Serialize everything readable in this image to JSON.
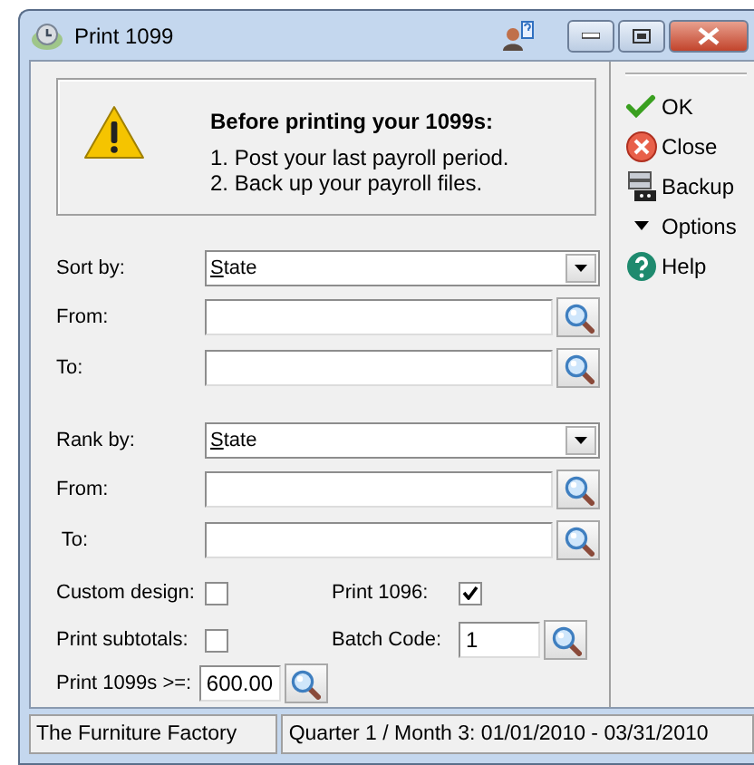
{
  "window": {
    "title": "Print 1099"
  },
  "notice": {
    "heading": "Before printing your 1099s:",
    "lines": [
      "1. Post your last payroll period.",
      "2. Back up your payroll files."
    ]
  },
  "sections": [
    {
      "rows": [
        {
          "kind": "select",
          "label": "Sort by:",
          "value": "State"
        },
        {
          "kind": "lookup",
          "label": "From:",
          "value": ""
        },
        {
          "kind": "lookup",
          "label": "To:",
          "value": ""
        }
      ]
    },
    {
      "rows": [
        {
          "kind": "select",
          "label": "Rank by:",
          "value": "State"
        },
        {
          "kind": "lookup",
          "label": "From:",
          "value": ""
        },
        {
          "kind": "lookup",
          "label": " To:",
          "value": ""
        }
      ]
    }
  ],
  "options": [
    [
      {
        "kind": "checkbox",
        "label": "Custom design:",
        "checked": false
      },
      {
        "kind": "checkbox",
        "label": "Print 1096:",
        "checked": true
      }
    ],
    [
      {
        "kind": "checkbox",
        "label": "Print subtotals:",
        "checked": false
      },
      {
        "kind": "lookup",
        "label": "Batch Code:",
        "value": "1"
      }
    ],
    [
      {
        "kind": "lookup",
        "label": "Print 1099s >=:",
        "value": "600.00"
      }
    ]
  ],
  "actions": [
    {
      "kind": "ok",
      "label": "OK"
    },
    {
      "kind": "close",
      "label": "Close"
    },
    {
      "kind": "backup",
      "label": "Backup"
    },
    {
      "kind": "menu",
      "label": "Options"
    },
    {
      "kind": "help",
      "label": "Help"
    }
  ],
  "status_bar": [
    "The Furniture Factory",
    "Quarter 1 / Month 3: 01/01/2010 - 03/31/2010"
  ]
}
